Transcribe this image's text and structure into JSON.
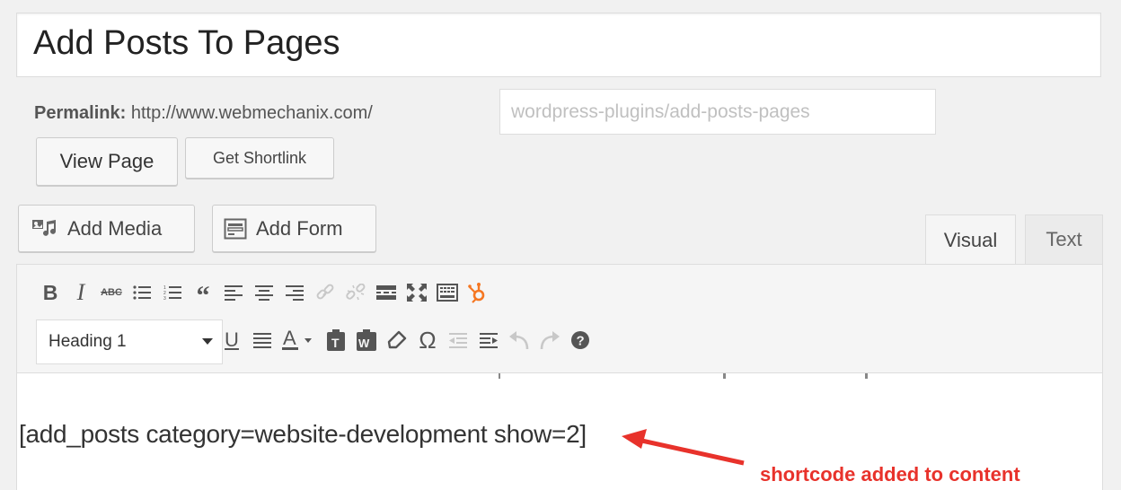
{
  "post": {
    "title": "Add Posts To Pages",
    "permalink_label": "Permalink:",
    "permalink_base": "http://www.webmechanix.com/",
    "slug": "wordpress-plugins/add-posts-pages"
  },
  "actions": {
    "view_page": "View Page",
    "get_shortlink": "Get Shortlink",
    "add_media": "Add Media",
    "add_form": "Add Form"
  },
  "tabs": {
    "visual": "Visual",
    "text": "Text"
  },
  "toolbar": {
    "row1_icons": [
      "bold-icon",
      "italic-icon",
      "strikethrough-icon",
      "bulleted-list-icon",
      "numbered-list-icon",
      "blockquote-icon",
      "align-left-icon",
      "align-center-icon",
      "align-right-icon",
      "insert-link-icon",
      "remove-link-icon",
      "read-more-icon",
      "fullscreen-icon",
      "toolbar-toggle-icon",
      "hubspot-icon"
    ],
    "format_select": "Heading 1",
    "row2_icons": [
      "underline-icon",
      "justify-icon",
      "text-color-icon",
      "paste-as-text-icon",
      "paste-from-word-icon",
      "clear-formatting-icon",
      "special-character-icon",
      "outdent-icon",
      "indent-icon",
      "undo-icon",
      "redo-icon",
      "help-icon"
    ]
  },
  "editor": {
    "content": "[add_posts category=website-development show=2]"
  },
  "annotation": {
    "text": "shortcode added to content",
    "color": "#e8322b"
  },
  "colors": {
    "hubspot": "#f57722",
    "annotation": "#e8322b"
  }
}
